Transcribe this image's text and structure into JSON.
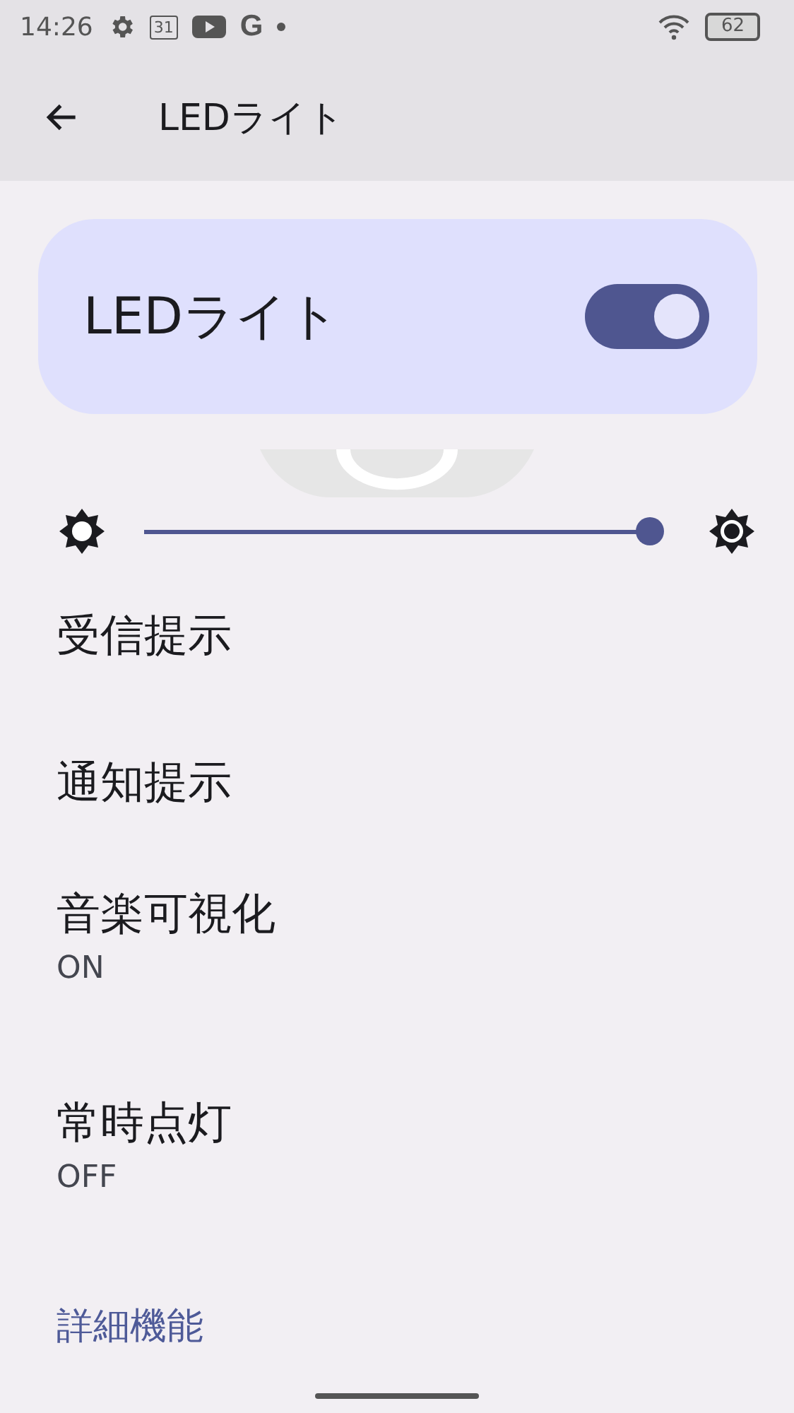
{
  "status_bar": {
    "time": "14:26",
    "calendar_day": "31",
    "google_letter": "G",
    "battery": "62"
  },
  "app_bar": {
    "title": "LEDライト"
  },
  "master_switch": {
    "label": "LEDライト",
    "on": true
  },
  "brightness": {
    "level": 0.99
  },
  "items": [
    {
      "title": "受信提示"
    },
    {
      "title": "通知提示"
    },
    {
      "title": "音楽可視化",
      "summary": "ON"
    },
    {
      "title": "常時点灯",
      "summary": "OFF"
    }
  ],
  "link": {
    "label": "詳細機能"
  }
}
